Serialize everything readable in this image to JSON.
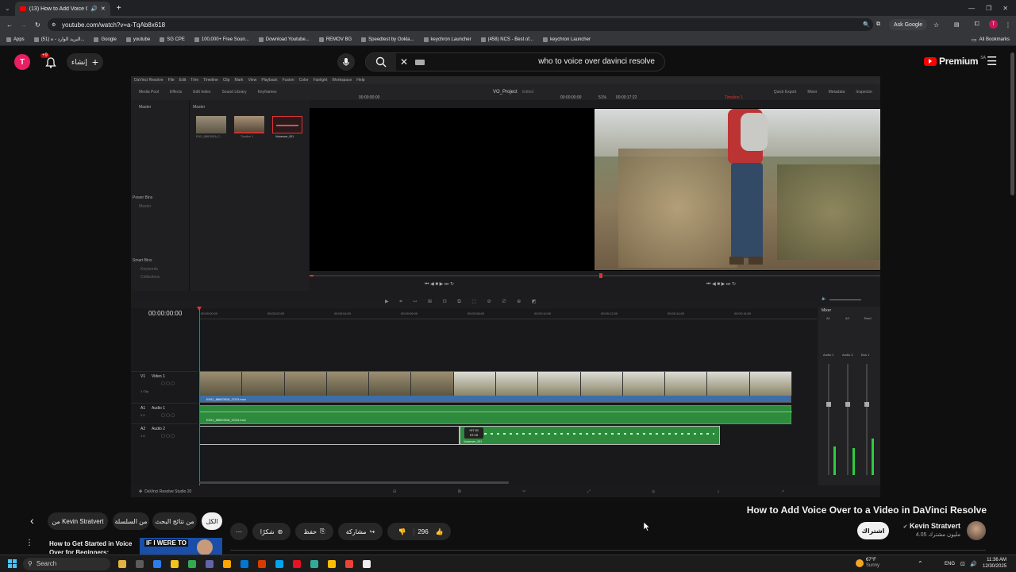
{
  "browser": {
    "tab_title": "(13) How to Add Voice Ov…",
    "url": "youtube.com/watch?v=a-TqAb8x618",
    "ask_google": "Ask Google",
    "bookmarks": [
      "Apps",
      "(51) البريد الوارد - ه...",
      "Google",
      "youtube",
      "SG CPE",
      "100,000+ Free Soun...",
      "Download Youtube...",
      "REMOV BG",
      "Speedtest by Ookla...",
      "keychron Launcher",
      "(458) NCS - Best of...",
      "keychron Launcher"
    ],
    "all_bookmarks": "All Bookmarks"
  },
  "youtube": {
    "avatar_letter": "T",
    "notif_count": "+9",
    "create_label": "إنشاء",
    "search_query": "who to voice over davinci resolve",
    "premium_label": "Premium",
    "premium_region": "SA"
  },
  "resolve": {
    "menu": [
      "DaVinci Resolve",
      "File",
      "Edit",
      "Trim",
      "Timeline",
      "Clip",
      "Mark",
      "View",
      "Playback",
      "Fusion",
      "Color",
      "Fairlight",
      "Workspace",
      "Help"
    ],
    "toolbar_left": [
      "Media Pool",
      "Effects",
      "Edit Index",
      "Sound Library",
      "Keyframes"
    ],
    "project_name": "VO_Project",
    "edited": "Edited",
    "toolbar_right": [
      "Quick Export",
      "Mixer",
      "Metadata",
      "Inspector"
    ],
    "source_timecode": "00:00:00:00",
    "zoom": "51%",
    "program_timecode": "00:00:17:22",
    "timeline_name": "Timeline 1",
    "pool_header": "Master",
    "pool_clips": [
      "E001_88620518_C...",
      "Timeline 1",
      "Voiceover_001"
    ],
    "power_bins": "Power Bins",
    "power_bins_master": "Master",
    "smart_bins": "Smart Bins",
    "smart_bins_items": [
      "Keywords",
      "Collections"
    ],
    "timeline_timecode": "00:00:00:00",
    "ruler": [
      "00:00:00:00",
      "00:00:02:00",
      "00:00:04:00",
      "00:00:06:00",
      "00:00:08:00",
      "00:00:10:00",
      "00:00:12:00",
      "00:00:14:00",
      "00:00:16:00"
    ],
    "tracks": [
      {
        "id": "V1",
        "name": "Video 1",
        "clip": "E001_88620518_C013.mov",
        "info": "1 Clip"
      },
      {
        "id": "A1",
        "name": "Audio 1",
        "clip": "E001_88620518_C013.mov",
        "level": "2.0"
      },
      {
        "id": "A2",
        "name": "Audio 2",
        "clip": "Voiceover_001",
        "level": "1.0"
      }
    ],
    "tooltip_offset": "+07:21",
    "tooltip_dur": "07:19",
    "mixer_title": "Mixer",
    "mixer_channels": [
      "A1",
      "A2",
      "Bus1"
    ],
    "mixer_labels": [
      "Audio 1",
      "Audio 2",
      "Bus 1"
    ],
    "footer": "DaVinci Resolve Studio 20"
  },
  "page": {
    "video_title": "How to Add Voice Over to a Video in DaVinci Resolve",
    "channel_name": "Kevin Stratvert",
    "subscribers": "4.05 مليون مشترك",
    "subscribe_label": "اشتراك",
    "likes": "296",
    "share_label": "مشاركة",
    "save_label": "حفظ",
    "thanks_label": "شكرًا",
    "filter_chips": [
      "الكل",
      "من نتائج البحث",
      "من السلسلة",
      "من Kevin Stratvert"
    ],
    "next_video_title": "How to Get Started in Voice Over for Beginners: Complete",
    "thumb_text": "IF I WERE TO"
  },
  "taskbar": {
    "search": "Search",
    "weather_temp": "67°F",
    "weather_desc": "Sunny",
    "lang": "ENG",
    "time": "11:36 AM",
    "date": "12/30/2025"
  },
  "colors": {
    "accent": "#ff0000",
    "audio_green": "#2e8b3e",
    "video_blue": "#3d6ea8"
  }
}
